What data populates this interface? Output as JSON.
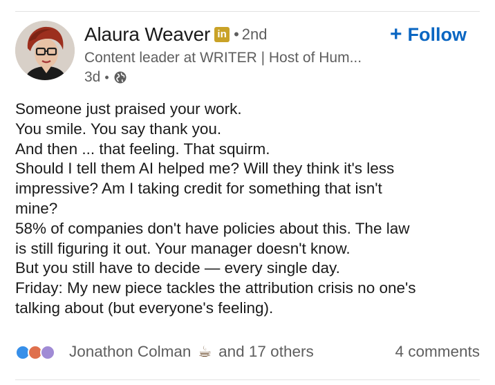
{
  "author": {
    "name": "Alaura Weaver",
    "badge": "in",
    "degree": "2nd",
    "headline": "Content leader at WRITER | Host of Hum...",
    "time_ago": "3d",
    "separator": "•"
  },
  "actions": {
    "follow_label": "Follow",
    "follow_symbol": "+"
  },
  "post": {
    "lines": [
      "Someone just praised your work.",
      "You smile. You say thank you.",
      "And then ... that feeling. That squirm.",
      "Should I tell them AI helped me? Will they think it's less",
      "impressive? Am I taking credit for something that isn't",
      "mine?",
      "58% of companies don't have policies about this. The law",
      "is still figuring it out. Your manager doesn't know.",
      "But you still have to decide — every single day.",
      "Friday: My new piece tackles the attribution crisis no one's",
      "talking about (but everyone's feeling)."
    ]
  },
  "social": {
    "reactor_name": "Jonathon Colman",
    "reactor_emoji": "☕",
    "others": "and 17 others",
    "comments": "4 comments"
  },
  "colors": {
    "accent": "#0a66c2",
    "muted_text": "#5e5e5e",
    "badge": "#c9a227"
  },
  "icons": [
    "globe-icon",
    "like-reaction-icon",
    "love-reaction-icon",
    "insightful-reaction-icon",
    "coffee-icon",
    "linkedin-badge-icon",
    "plus-icon"
  ]
}
